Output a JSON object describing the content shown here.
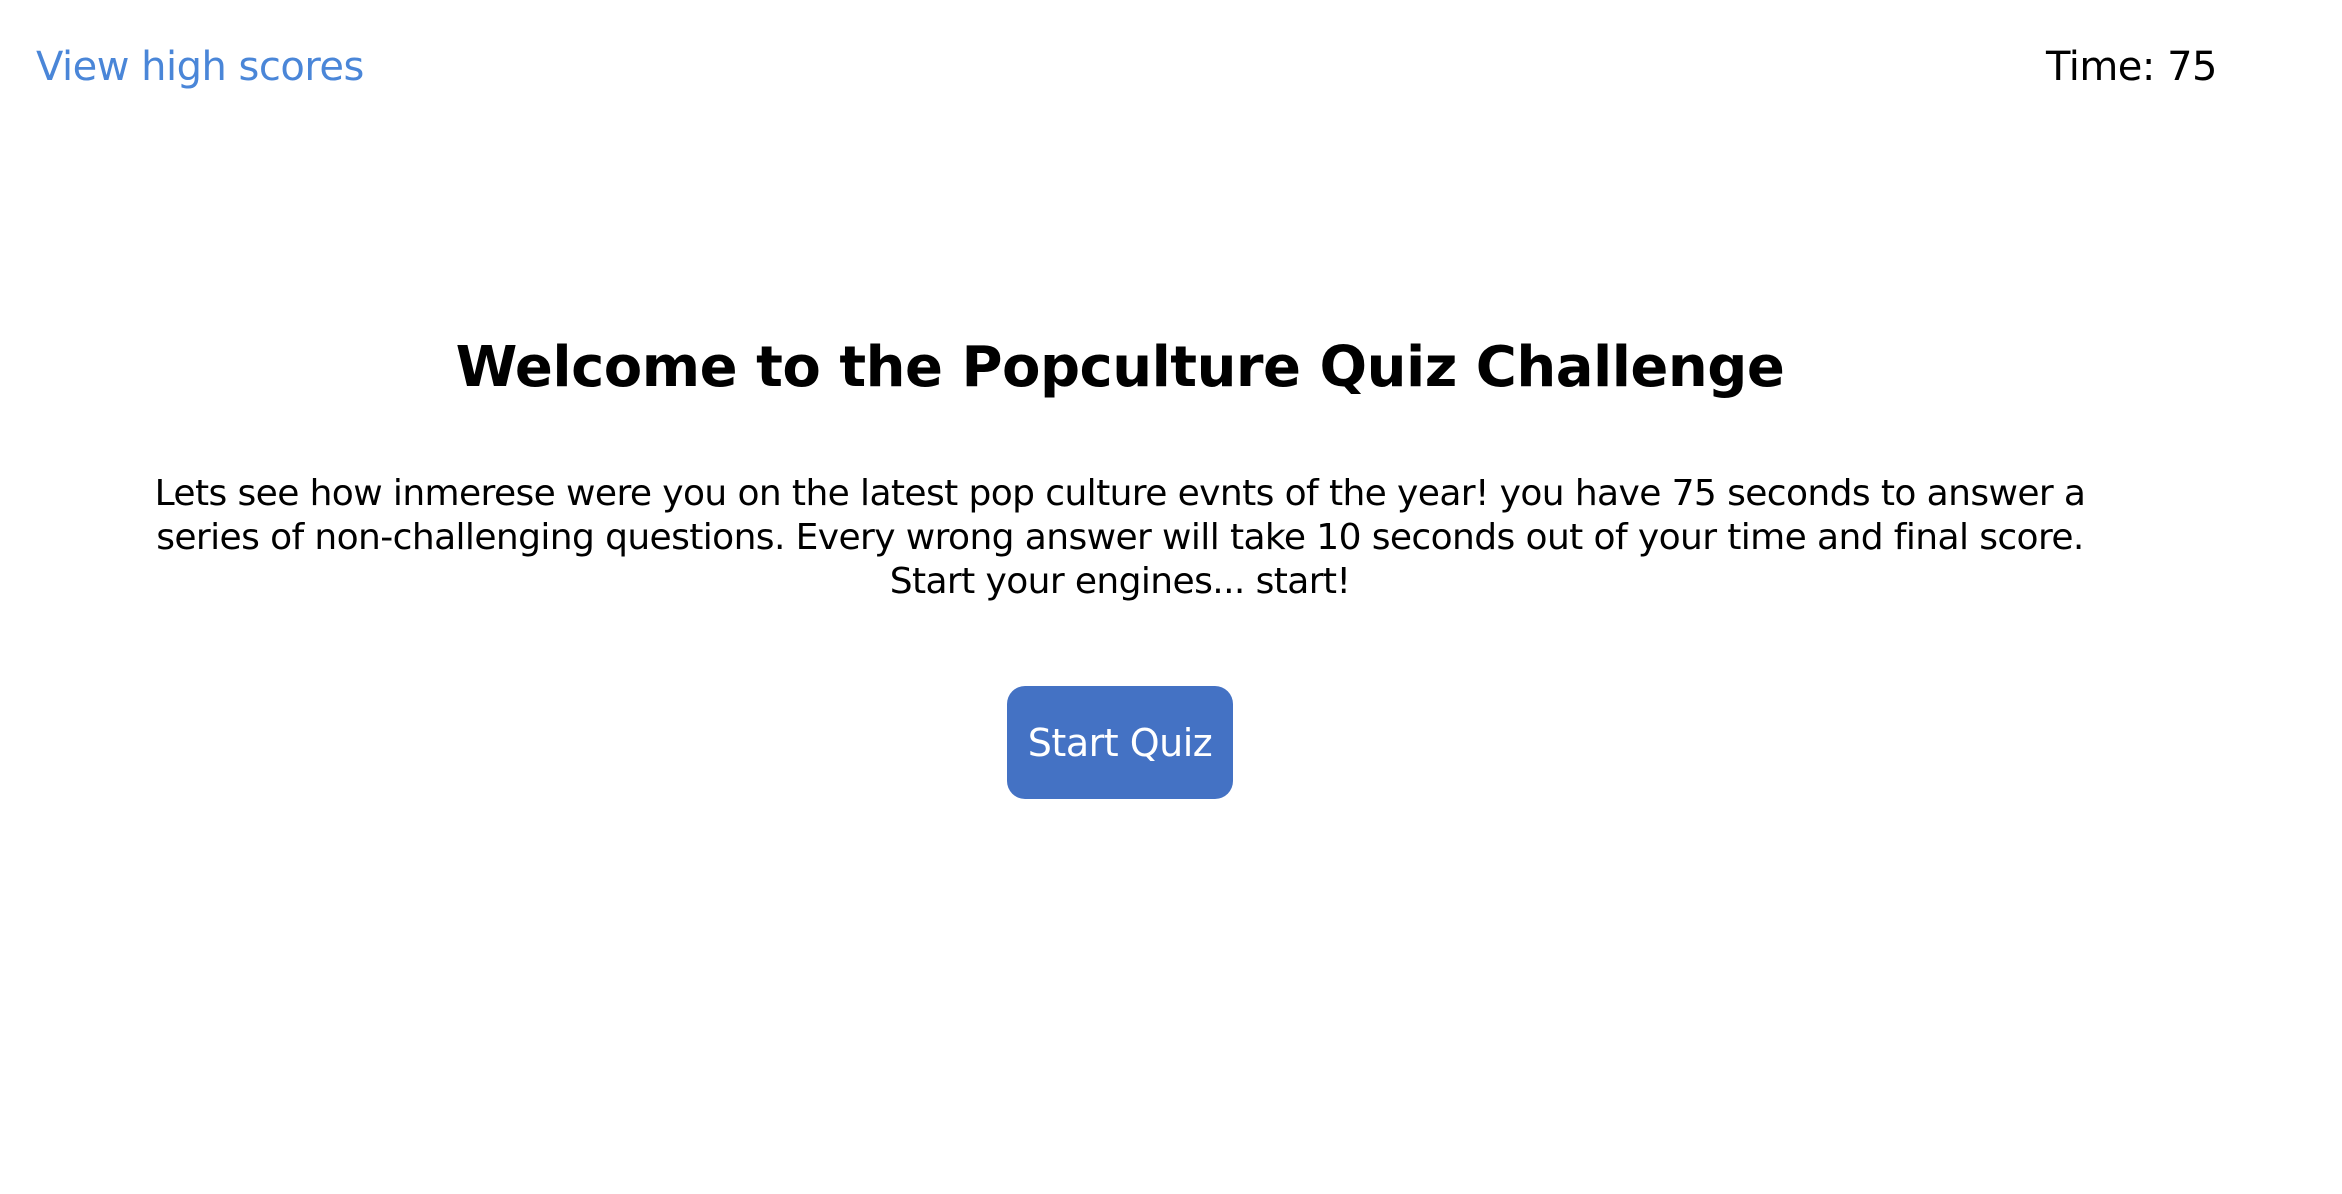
{
  "header": {
    "high_scores_label": "View high scores",
    "timer_label": "Time: ",
    "timer_value": "75"
  },
  "intro": {
    "title": "Welcome to the Popculture Quiz Challenge",
    "description": "Lets see how inmerese were you on the latest pop culture evnts of the year! you have 75 seconds to answer a series of non-challenging questions. Every wrong answer will take 10 seconds out of your time and final score. Start your engines... start!",
    "start_button_label": "Start Quiz"
  },
  "colors": {
    "link": "#4a86d8",
    "button": "#4472c4",
    "button_text": "#ffffff",
    "background": "#ffffff",
    "text": "#000000"
  }
}
